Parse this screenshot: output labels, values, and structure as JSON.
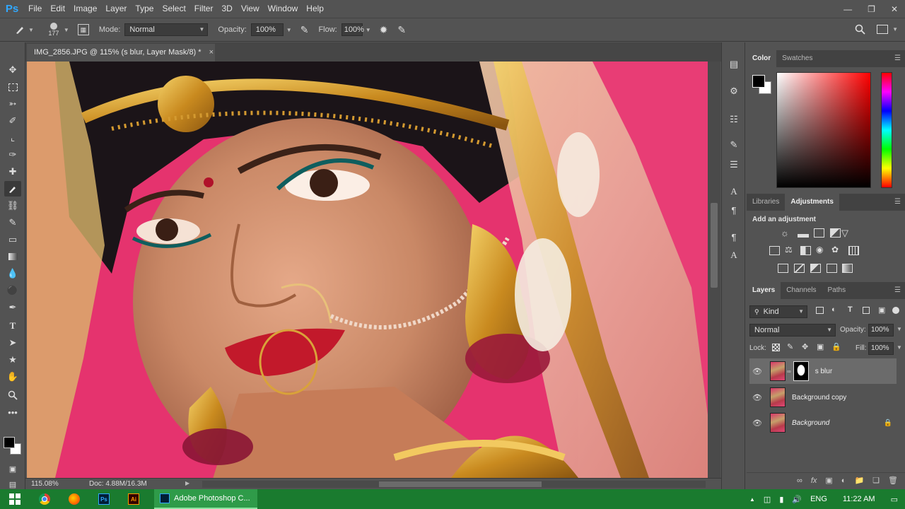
{
  "app": {
    "logo": "Ps"
  },
  "menu": [
    "File",
    "Edit",
    "Image",
    "Layer",
    "Type",
    "Select",
    "Filter",
    "3D",
    "View",
    "Window",
    "Help"
  ],
  "options": {
    "brush_size": "177",
    "mode_label": "Mode:",
    "mode_value": "Normal",
    "opacity_label": "Opacity:",
    "opacity_value": "100%",
    "flow_label": "Flow:",
    "flow_value": "100%"
  },
  "document": {
    "tab_title": "IMG_2856.JPG @ 115% (s blur, Layer Mask/8) *",
    "zoom": "115.08%",
    "doc_size": "Doc: 4.88M/16.3M"
  },
  "color_panel": {
    "tabs": [
      "Color",
      "Swatches"
    ],
    "active": "Color",
    "fg_color": "#000000",
    "bg_color": "#ffffff",
    "hue_color": "#ff0000"
  },
  "adjustments_panel": {
    "tabs": [
      "Libraries",
      "Adjustments"
    ],
    "active": "Adjustments",
    "heading": "Add an adjustment"
  },
  "layers_panel": {
    "tabs": [
      "Layers",
      "Channels",
      "Paths"
    ],
    "active": "Layers",
    "filter_kind": "Kind",
    "blend_mode": "Normal",
    "opacity_label": "Opacity:",
    "opacity_value": "100%",
    "lock_label": "Lock:",
    "fill_label": "Fill:",
    "fill_value": "100%",
    "layers": [
      {
        "name": "s blur",
        "selected": true,
        "has_mask": true,
        "locked": false
      },
      {
        "name": "Background copy",
        "selected": false,
        "has_mask": false,
        "locked": false
      },
      {
        "name": "Background",
        "selected": false,
        "has_mask": false,
        "locked": true
      }
    ]
  },
  "taskbar": {
    "active_app": "Adobe Photoshop C...",
    "language": "ENG",
    "time": "11:22 AM"
  }
}
